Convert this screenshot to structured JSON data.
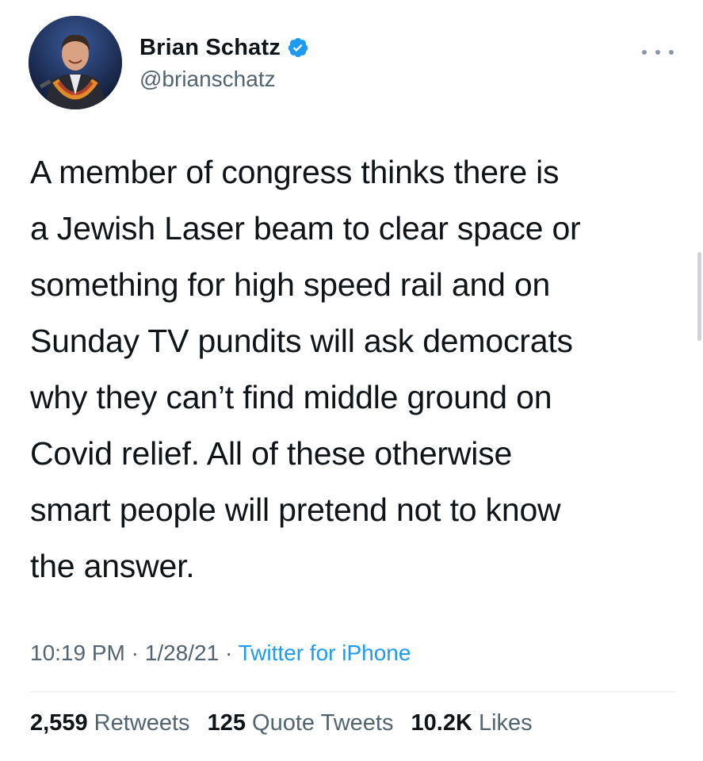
{
  "author": {
    "display_name": "Brian Schatz",
    "handle": "@brianschatz",
    "verified_icon": "verified-badge-icon"
  },
  "tweet": {
    "text": "A member of congress thinks there is\na Jewish Laser beam to clear space or\nsomething for high speed rail and on\nSunday TV pundits will ask democrats\nwhy they can’t find middle ground on\nCovid relief. All of these otherwise\nsmart people will pretend not to know\nthe answer.",
    "time": "10:19 PM",
    "date": "1/28/21",
    "separator": " · ",
    "source": "Twitter for iPhone"
  },
  "stats": {
    "retweets_count": "2,559",
    "retweets_label": "Retweets",
    "quotes_count": "125",
    "quotes_label": "Quote Tweets",
    "likes_count": "10.2K",
    "likes_label": "Likes"
  },
  "colors": {
    "accent": "#1d9bf0",
    "secondary_text": "#536471",
    "primary_text": "#0f1419"
  }
}
